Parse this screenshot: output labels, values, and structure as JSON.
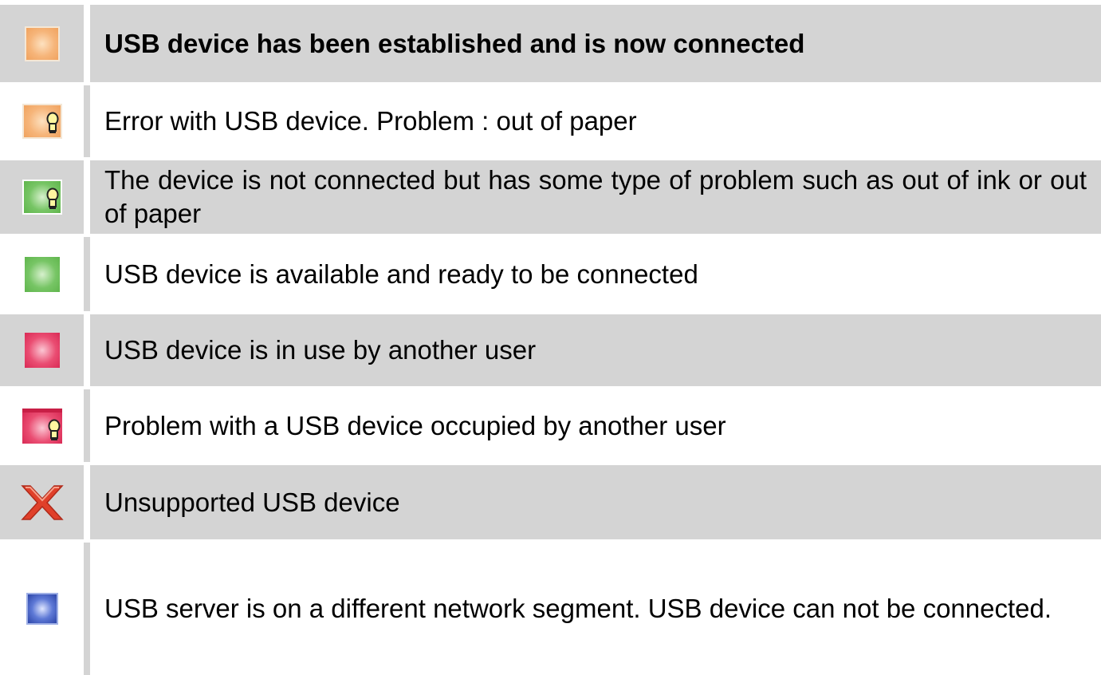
{
  "rows": [
    {
      "label": "USB device has been established and is now connected",
      "icon": "orange-connected-icon",
      "color": "#f6b57a"
    },
    {
      "label": "Error with USB device. Problem : out of paper",
      "icon": "orange-error-bulb-icon",
      "color": "#f6b57a"
    },
    {
      "label": "The device is not connected but has some type of problem such as out of ink or out of paper",
      "icon": "green-problem-bulb-icon",
      "color": "#77c565"
    },
    {
      "label": "USB device is available and ready to be connected",
      "icon": "green-available-icon",
      "color": "#77c565"
    },
    {
      "label": "USB device is in use by another user",
      "icon": "red-in-use-icon",
      "color": "#ea4d72"
    },
    {
      "label": "Problem with a USB device occupied by another user",
      "icon": "red-problem-bulb-icon",
      "color": "#ea4d72"
    },
    {
      "label": "Unsupported USB device",
      "icon": "red-x-unsupported-icon",
      "color": "#e0402a"
    },
    {
      "label": "USB server is on a different network segment. USB device can not be connected.",
      "icon": "blue-segment-icon",
      "color": "#5e79d6"
    }
  ]
}
